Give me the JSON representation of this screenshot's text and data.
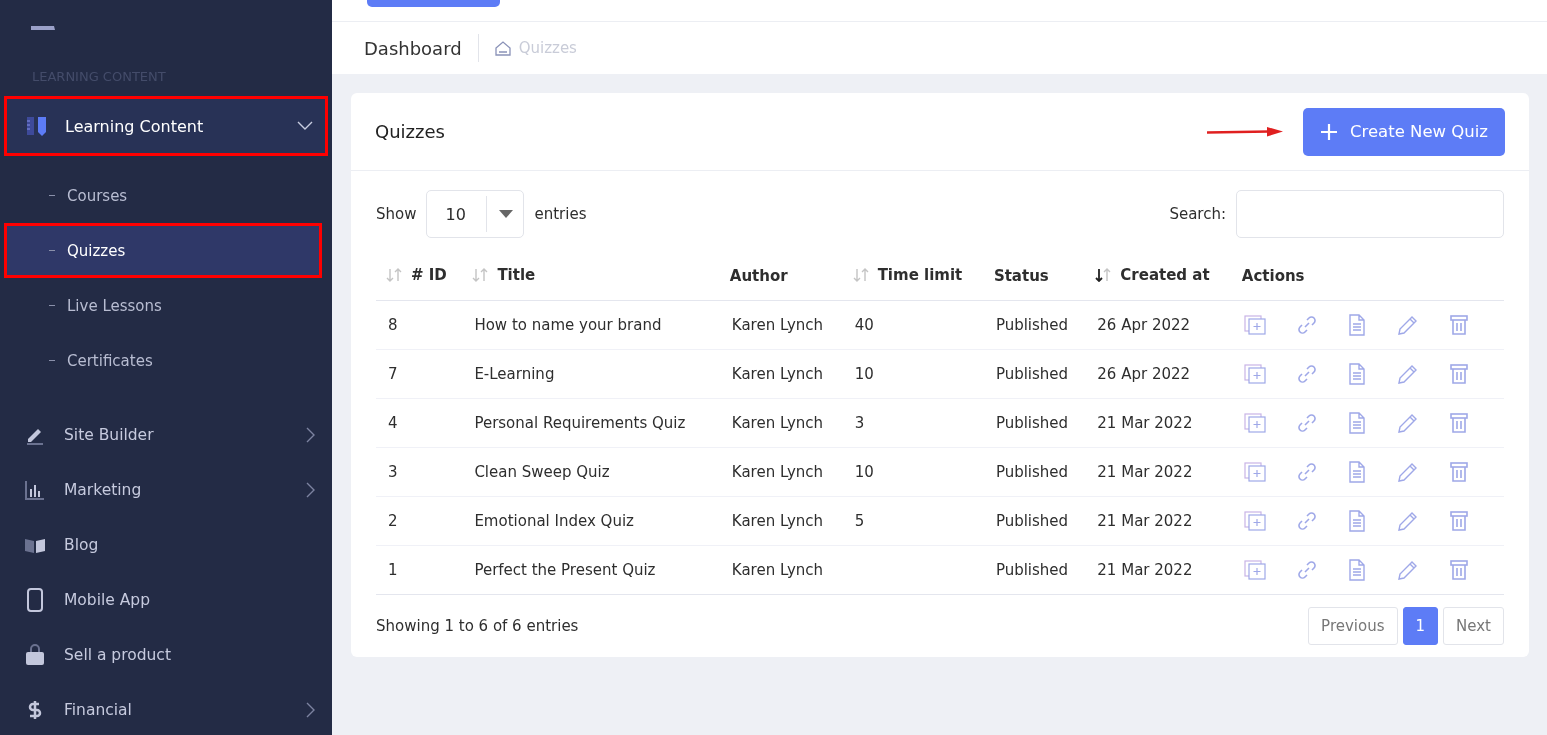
{
  "sidebar": {
    "section_label": "LEARNING CONTENT",
    "group": {
      "label": "Learning Content",
      "expanded": true,
      "highlighted": true,
      "children": [
        {
          "label": "Courses",
          "selected": false,
          "highlighted": false
        },
        {
          "label": "Quizzes",
          "selected": true,
          "highlighted": true
        },
        {
          "label": "Live Lessons",
          "selected": false,
          "highlighted": false
        },
        {
          "label": "Certificates",
          "selected": false,
          "highlighted": false
        }
      ]
    },
    "items": [
      {
        "label": "Site Builder",
        "kind": "pencil",
        "has_submenu": true
      },
      {
        "label": "Marketing",
        "kind": "chart",
        "has_submenu": true
      },
      {
        "label": "Blog",
        "kind": "book",
        "has_submenu": false
      },
      {
        "label": "Mobile App",
        "kind": "phone",
        "has_submenu": false
      },
      {
        "label": "Sell a product",
        "kind": "bag",
        "has_submenu": false
      },
      {
        "label": "Financial",
        "kind": "dollar",
        "has_submenu": true
      }
    ]
  },
  "breadcrumb": {
    "title": "Dashboard",
    "current": "Quizzes"
  },
  "card": {
    "title": "Quizzes",
    "create_button": "Create New Quiz",
    "arrow_annotation": true,
    "show_label": "Show",
    "page_size": "10",
    "entries_label": "entries",
    "search_label": "Search:",
    "columns": [
      {
        "label": "# ID",
        "sortable": true,
        "sorted": false
      },
      {
        "label": "Title",
        "sortable": true,
        "sorted": false
      },
      {
        "label": "Author",
        "sortable": false,
        "sorted": false
      },
      {
        "label": "Time limit",
        "sortable": true,
        "sorted": false
      },
      {
        "label": "Status",
        "sortable": false,
        "sorted": false
      },
      {
        "label": "Created at",
        "sortable": true,
        "sorted": true
      },
      {
        "label": "Actions",
        "sortable": false,
        "sorted": false
      }
    ],
    "rows": [
      {
        "id": "8",
        "title": "How to name your brand",
        "author": "Karen Lynch",
        "time_limit": "40",
        "status": "Published",
        "created": "26 Apr 2022"
      },
      {
        "id": "7",
        "title": "E-Learning",
        "author": "Karen Lynch",
        "time_limit": "10",
        "status": "Published",
        "created": "26 Apr 2022"
      },
      {
        "id": "4",
        "title": "Personal Requirements Quiz",
        "author": "Karen Lynch",
        "time_limit": "3",
        "status": "Published",
        "created": "21 Mar 2022"
      },
      {
        "id": "3",
        "title": "Clean Sweep Quiz",
        "author": "Karen Lynch",
        "time_limit": "10",
        "status": "Published",
        "created": "21 Mar 2022"
      },
      {
        "id": "2",
        "title": "Emotional Index Quiz",
        "author": "Karen Lynch",
        "time_limit": "5",
        "status": "Published",
        "created": "21 Mar 2022"
      },
      {
        "id": "1",
        "title": "Perfect the Present Quiz",
        "author": "Karen Lynch",
        "status": "Published",
        "created": "21 Mar 2022"
      }
    ],
    "info": "Showing 1 to 6 of 6 entries",
    "pagination": {
      "previous": "Previous",
      "pages": [
        {
          "label": "1",
          "selected": true
        }
      ],
      "next": "Next"
    }
  }
}
